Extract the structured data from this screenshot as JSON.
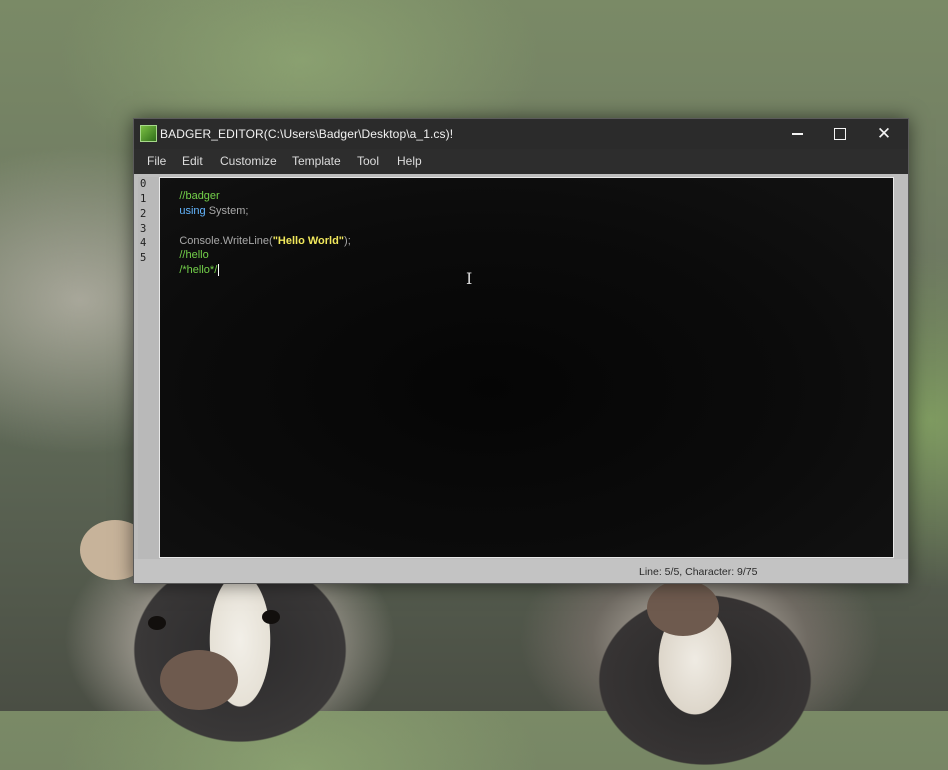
{
  "window": {
    "title": "BADGER_EDITOR(C:\\Users\\Badger\\Desktop\\a_1.cs)!",
    "controls": {
      "minimize_icon": "minimize-icon",
      "maximize_icon": "maximize-icon",
      "close_glyph": "✕"
    }
  },
  "menu": [
    {
      "label": "File"
    },
    {
      "label": "Edit"
    },
    {
      "label": "Customize"
    },
    {
      "label": "Template"
    },
    {
      "label": "Tool"
    },
    {
      "label": "Help"
    }
  ],
  "editor": {
    "line_numbers": [
      "0",
      "1",
      "2",
      "3",
      "4",
      "5"
    ],
    "lines": [
      {
        "tokens": [
          {
            "text": "//badger",
            "kind": "comment"
          }
        ]
      },
      {
        "tokens": [
          {
            "text": "using",
            "kind": "keyword"
          },
          {
            "text": " System;",
            "kind": "plain"
          }
        ]
      },
      {
        "tokens": []
      },
      {
        "tokens": [
          {
            "text": "Console.WriteLine(",
            "kind": "plain"
          },
          {
            "text": "\"Hello World\"",
            "kind": "string"
          },
          {
            "text": ");",
            "kind": "plain"
          }
        ]
      },
      {
        "tokens": [
          {
            "text": "//hello",
            "kind": "comment"
          }
        ]
      },
      {
        "tokens": [
          {
            "text": "/*hello*/",
            "kind": "comment"
          }
        ]
      }
    ],
    "cursor_icon": "text-cursor-icon"
  },
  "status": {
    "text": "Line: 5/5, Character: 9/75"
  },
  "colors": {
    "comment": "#74d14a",
    "keyword": "#64b6ff",
    "plain": "#a9a9a9",
    "string": "#f1e85c",
    "titlebar": "#2b2b2b",
    "editor_bg": "#0b0b0b"
  }
}
